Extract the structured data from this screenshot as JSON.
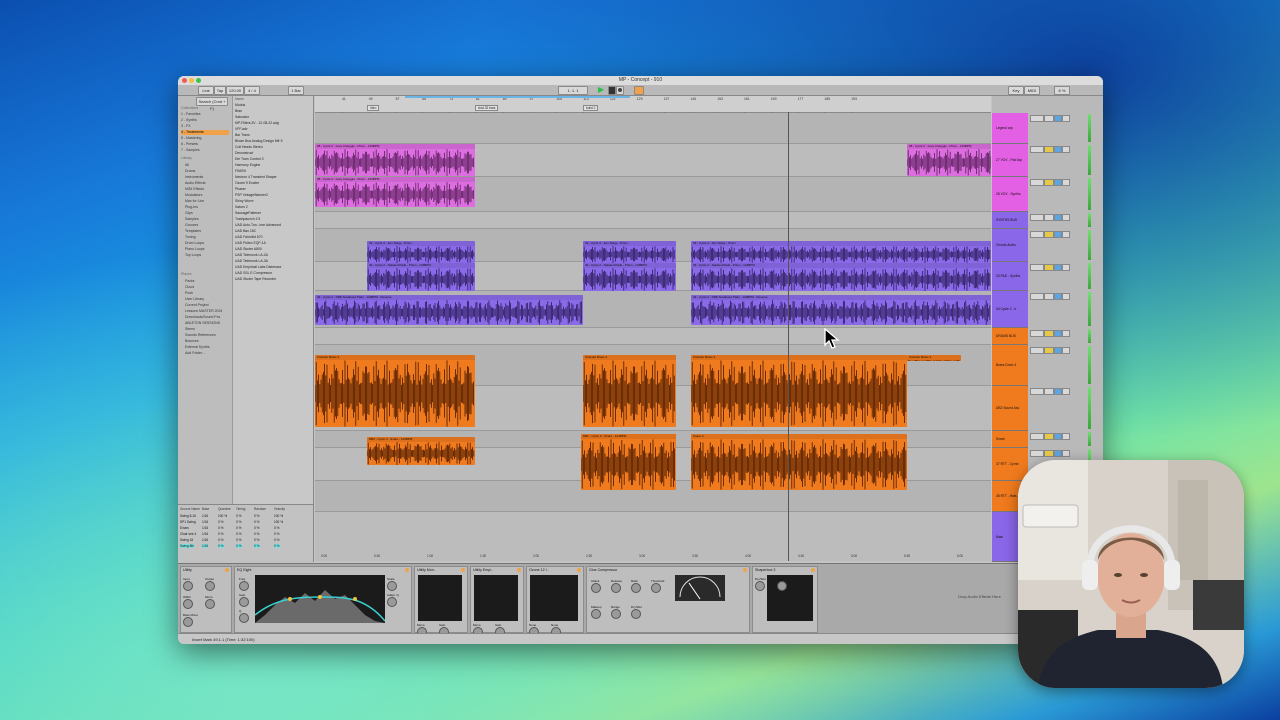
{
  "window": {
    "title": "MP - Concept - 910"
  },
  "transport": {
    "tempo": "120.00",
    "sig": "4 / 4",
    "quant": "1 Bar",
    "position": "1. 1. 1",
    "key_label": "Key",
    "midi_label": "MIDI",
    "cpu": "6 %"
  },
  "browser": {
    "search_placeholder": "Search (Cmd + F)",
    "collections_label": "Collections",
    "collections": [
      "1 - Favorites",
      "2 - Synths",
      "3 - FX",
      "4 - Treatments",
      "5 - Mastering",
      "6 - Presets",
      "7 - Samples"
    ],
    "selected_collection": 3,
    "library_label": "Library",
    "library": [
      "All",
      "Drums",
      "Instruments",
      "Audio Effects",
      "MIDI Effects",
      "Modulators",
      "Max for Live",
      "Plug-Ins",
      "Clips",
      "Samples",
      "Grooves",
      "Templates",
      "Tuning",
      "Drum Loops",
      "Piano Loops",
      "Top Loops"
    ],
    "places_label": "Places",
    "places": [
      "Packs",
      "Cloud",
      "Push",
      "User Library",
      "Current Project",
      "Lessons MASTER 2024",
      "Downloads/Sound Pcs",
      "ABLETON SESSIONS",
      "Stems",
      "Sounds References",
      "Bounces",
      "External Synths",
      "Add Folder..."
    ],
    "files_header": "Name",
    "files": [
      "Modus",
      "Bran",
      "Saturator",
      "MP-Filters.3V - 12-08-22.adg",
      "VFF.adv",
      "Bar Trans",
      "Blown Bus Analog Design Mfr 5",
      "Cult Heads Stereo",
      "Deconstruct",
      "Die Tram Control 3",
      "Harmony Engine",
      "FINISH",
      "Neutron 4 Transient Shaper",
      "Ozone 9 Exciter",
      "Phaser",
      "PSP VintageWarmer2",
      "Shiny Worm",
      "Saturn 2",
      "SausageFattener",
      "Trashpaunch 2.9",
      "UAD Auto-Tun...ime Advanced",
      "UAD Bax 18C",
      "UAD Fairchild 670",
      "UAD Pultec EQP-1A",
      "UAD Studer A800",
      "UAD Telemunk LA-2A",
      "UAD Telemunk LA-3A",
      "UAD Empirical Labs Distressor",
      "UAD SSL E Compressor",
      "UAD Studer Tape Recorder"
    ]
  },
  "groove_pool": {
    "columns": [
      "Groove Name",
      "Base",
      "Quantize",
      "Timing",
      "Random",
      "Velocity"
    ],
    "rows": [
      [
        "Swing 8-16",
        "1/16",
        "100 %",
        "0 %",
        "0 %",
        "100 %"
      ],
      [
        "SP1 Swing",
        "1/16",
        "0 %",
        "0 %",
        "0 %",
        "100 %"
      ],
      [
        "8 bars",
        "1/16",
        "0 %",
        "0 %",
        "0 %",
        "0 %"
      ],
      [
        "Chair see 4",
        "1/16",
        "0 %",
        "0 %",
        "0 %",
        "0 %"
      ],
      [
        "Swing 16",
        "1/16",
        "0 %",
        "0 %",
        "0 %",
        "0 %"
      ],
      [
        "Swing 8th",
        "1/16",
        "0 %",
        "0 %",
        "0 %",
        "0 %"
      ]
    ],
    "footer": "Global Amount",
    "global_amount": "100 %"
  },
  "arrangement": {
    "bar_numbers": [
      "41",
      "49",
      "57",
      "65",
      "73",
      "81",
      "89",
      "97",
      "105",
      "113",
      "121",
      "129",
      "137",
      "145",
      "153",
      "161",
      "169",
      "177",
      "185",
      "193"
    ],
    "locators": [
      "Intro",
      "Add-32 bars",
      "build 2"
    ],
    "time_labels": [
      "0:00",
      "0:30",
      "1:00",
      "1:30",
      "2:00",
      "2:30",
      "3:00",
      "3:30",
      "4:00",
      "4:30",
      "5:00",
      "5:30",
      "6:00"
    ]
  },
  "tracks": [
    {
      "name": "Legend arp",
      "color": "#e35fe3"
    },
    {
      "name": "27 VOX - Pad Arp",
      "color": "#e35fe3"
    },
    {
      "name": "28 VOX - Synths",
      "color": "#e35fe3"
    },
    {
      "name": "SYNTHS BUS",
      "color": "#8a66e8"
    },
    {
      "name": "Chords Audio",
      "color": "#8a66e8"
    },
    {
      "name": "33 PAD - Synths",
      "color": "#8a66e8"
    },
    {
      "name": "34 Cycle 2 - Ir",
      "color": "#8a66e8"
    },
    {
      "name": "DRUMS BUS",
      "color": "#f07a1e"
    },
    {
      "name": "Brass Drum 4",
      "color": "#f07a1e"
    },
    {
      "name": "DB2 Sound Ass",
      "color": "#f07a1e"
    },
    {
      "name": "Snare",
      "color": "#f07a1e"
    },
    {
      "name": "37 RTT - Cymb",
      "color": "#f07a1e"
    },
    {
      "name": "38 RTT - Hats",
      "color": "#f07a1e"
    },
    {
      "name": "Main",
      "color": "#8a66e8"
    }
  ],
  "clips": {
    "pink_1": "28 - Cycle 2 - Grey Arpeggio - Prism - 133BPM",
    "pink_2": "28 - Cycle 2 - Grey Arpeggio - Prism - 133BPM",
    "purple_1": "33 - Cycle 2 - Zen Stage - Prism",
    "purple_2": "33 - Cycle 2 - Stacked Pads - Prism - 124BPM",
    "purple_3": "34 - Cycle 2 - DBE Sustained Pads - 124BPM - Reverse",
    "orange_1": "Ostinato Brass 4",
    "orange_2": "DB2 - Cycle 3 - Snare - 124BPM",
    "orange_3": "Snare 4"
  },
  "devices": [
    {
      "name": "Utility",
      "labels": [
        "Input",
        "Output",
        "Width",
        "Mono",
        "Bass Mono"
      ]
    },
    {
      "name": "EQ Eight",
      "labels": [
        "Freq",
        "Gain",
        "Q",
        "Scale",
        "Adapt. Q"
      ]
    },
    {
      "name": "Utility Mon..",
      "labels": [
        "Mono",
        "Gain"
      ]
    },
    {
      "name": "Utility Empi..",
      "labels": [
        "Mono",
        "Gain"
      ]
    },
    {
      "name": "Ozone 12 I..",
      "labels": [
        "None",
        "None"
      ]
    },
    {
      "name": "Glue Compressor",
      "labels": [
        "Attack",
        "Release",
        "Ratio",
        "Threshold",
        "Makeup",
        "Range",
        "Dry/Wet"
      ]
    },
    {
      "name": "Shaperbox 3",
      "labels": [
        "Dry/Wet",
        "Gain"
      ]
    }
  ],
  "drop_hint": "Drop Audio Effects Here",
  "status_bar": "Insert Mark 49.1.1 (Time: 1:32:100)",
  "status_right": "SOS Bus"
}
